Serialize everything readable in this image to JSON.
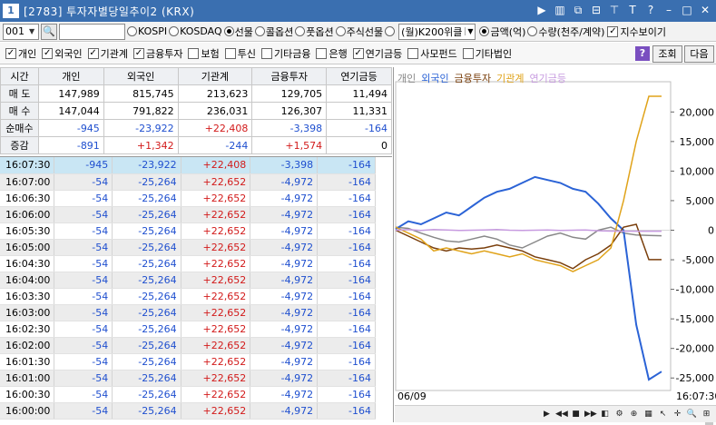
{
  "window": {
    "number": "1",
    "title": "[2783] 투자자별당일추이2 (KRX)",
    "icons": [
      "arrow-right-icon",
      "menu-icon",
      "copy-icon",
      "link-icon",
      "pin-icon",
      "text-icon",
      "help-icon",
      "minimize-icon",
      "maximize-icon",
      "close-icon"
    ]
  },
  "toolbar1": {
    "code_value": "001",
    "market_options": [
      "KOSPI",
      "KOSDAQ",
      "선물",
      "콜옵션",
      "풋옵션",
      "주식선물"
    ],
    "market_selected": "선물",
    "select_value": "(월)K200위클",
    "unit_options": [
      "금액(억)",
      "수량(천주/계약)"
    ],
    "unit_selected": "금액(억)",
    "index_check_label": "지수보이기"
  },
  "toolbar2": {
    "checks": [
      {
        "label": "개인",
        "checked": true
      },
      {
        "label": "외국인",
        "checked": true
      },
      {
        "label": "기관계",
        "checked": true
      },
      {
        "label": "금융투자",
        "checked": true
      },
      {
        "label": "보험",
        "checked": false
      },
      {
        "label": "투신",
        "checked": false
      },
      {
        "label": "기타금융",
        "checked": false
      },
      {
        "label": "은행",
        "checked": false
      },
      {
        "label": "연기금등",
        "checked": true
      },
      {
        "label": "사모펀드",
        "checked": false
      },
      {
        "label": "기타법인",
        "checked": false
      }
    ],
    "help_label": "?",
    "query_label": "조회",
    "next_label": "다음"
  },
  "summary": {
    "headers": [
      "시간",
      "개인",
      "외국인",
      "기관계",
      "금융투자",
      "연기금등"
    ],
    "rows": [
      {
        "label": "매 도",
        "values": [
          "147,989",
          "815,745",
          "213,623",
          "129,705",
          "11,494"
        ],
        "colors": [
          "",
          "",
          "",
          "",
          ""
        ]
      },
      {
        "label": "매 수",
        "values": [
          "147,044",
          "791,822",
          "236,031",
          "126,307",
          "11,331"
        ],
        "colors": [
          "",
          "",
          "",
          "",
          ""
        ]
      },
      {
        "label": "순매수",
        "values": [
          "-945",
          "-23,922",
          "+22,408",
          "-3,398",
          "-164"
        ],
        "colors": [
          "blue",
          "blue",
          "red",
          "blue",
          "blue"
        ]
      },
      {
        "label": "증감",
        "values": [
          "-891",
          "+1,342",
          "-244",
          "+1,574",
          "0"
        ],
        "colors": [
          "blue",
          "red",
          "blue",
          "red",
          ""
        ]
      }
    ]
  },
  "timeline": [
    {
      "time": "16:07:30",
      "values": [
        "-945",
        "-23,922",
        "+22,408",
        "-3,398",
        "-164"
      ]
    },
    {
      "time": "16:07:00",
      "values": [
        "-54",
        "-25,264",
        "+22,652",
        "-4,972",
        "-164"
      ]
    },
    {
      "time": "16:06:30",
      "values": [
        "-54",
        "-25,264",
        "+22,652",
        "-4,972",
        "-164"
      ]
    },
    {
      "time": "16:06:00",
      "values": [
        "-54",
        "-25,264",
        "+22,652",
        "-4,972",
        "-164"
      ]
    },
    {
      "time": "16:05:30",
      "values": [
        "-54",
        "-25,264",
        "+22,652",
        "-4,972",
        "-164"
      ]
    },
    {
      "time": "16:05:00",
      "values": [
        "-54",
        "-25,264",
        "+22,652",
        "-4,972",
        "-164"
      ]
    },
    {
      "time": "16:04:30",
      "values": [
        "-54",
        "-25,264",
        "+22,652",
        "-4,972",
        "-164"
      ]
    },
    {
      "time": "16:04:00",
      "values": [
        "-54",
        "-25,264",
        "+22,652",
        "-4,972",
        "-164"
      ]
    },
    {
      "time": "16:03:30",
      "values": [
        "-54",
        "-25,264",
        "+22,652",
        "-4,972",
        "-164"
      ]
    },
    {
      "time": "16:03:00",
      "values": [
        "-54",
        "-25,264",
        "+22,652",
        "-4,972",
        "-164"
      ]
    },
    {
      "time": "16:02:30",
      "values": [
        "-54",
        "-25,264",
        "+22,652",
        "-4,972",
        "-164"
      ]
    },
    {
      "time": "16:02:00",
      "values": [
        "-54",
        "-25,264",
        "+22,652",
        "-4,972",
        "-164"
      ]
    },
    {
      "time": "16:01:30",
      "values": [
        "-54",
        "-25,264",
        "+22,652",
        "-4,972",
        "-164"
      ]
    },
    {
      "time": "16:01:00",
      "values": [
        "-54",
        "-25,264",
        "+22,652",
        "-4,972",
        "-164"
      ]
    },
    {
      "time": "16:00:30",
      "values": [
        "-54",
        "-25,264",
        "+22,652",
        "-4,972",
        "-164"
      ]
    },
    {
      "time": "16:00:00",
      "values": [
        "-54",
        "-25,264",
        "+22,652",
        "-4,972",
        "-164"
      ]
    }
  ],
  "colors": {
    "title_bar": "#3a6fb0",
    "negative": "#1f4fcf",
    "positive": "#d21a1a",
    "selected_row": "#c9e6f4"
  },
  "chart_data": {
    "type": "line",
    "legend": [
      "개인",
      "외국인",
      "금융투자",
      "기관계",
      "연기금등"
    ],
    "legend_colors": [
      "#888888",
      "#2b63d6",
      "#7a3f0c",
      "#e0a31a",
      "#c79be0"
    ],
    "x_start_label": "06/09",
    "x_end_label": "16:07:30",
    "ylim": [
      -26500,
      24500
    ],
    "yticks": [
      20000,
      15000,
      10000,
      5000,
      0,
      -5000,
      -10000,
      -15000,
      -20000,
      -25000
    ],
    "ytick_labels": [
      "20,000",
      "15,000",
      "10,000",
      "5,000",
      "0",
      "-5,000",
      "-10,000",
      "-15,000",
      "-20,000",
      "-25,000"
    ],
    "series": [
      {
        "name": "개인",
        "color": "#888888",
        "values": [
          500,
          300,
          -500,
          -1200,
          -1800,
          -2000,
          -1500,
          -1000,
          -1500,
          -2500,
          -3000,
          -2000,
          -1000,
          -500,
          -1200,
          -1500,
          0,
          500,
          -500,
          -800,
          -900,
          -945
        ]
      },
      {
        "name": "외국인",
        "color": "#2b63d6",
        "values": [
          200,
          1500,
          1000,
          2000,
          3000,
          2500,
          4000,
          5500,
          6500,
          7000,
          8000,
          9000,
          8500,
          8000,
          7000,
          6500,
          4500,
          2000,
          0,
          -16000,
          -25264,
          -23922
        ]
      },
      {
        "name": "금융투자",
        "color": "#7a3f0c",
        "values": [
          0,
          -1000,
          -2000,
          -3000,
          -3500,
          -3000,
          -3200,
          -3000,
          -2500,
          -3000,
          -3500,
          -4500,
          -5000,
          -5500,
          -6500,
          -5000,
          -4000,
          -2500,
          500,
          1000,
          -4972,
          -4972
        ]
      },
      {
        "name": "기관계",
        "color": "#e0a31a",
        "values": [
          500,
          -500,
          -1500,
          -3500,
          -3000,
          -3500,
          -4000,
          -3500,
          -4000,
          -4500,
          -4000,
          -5000,
          -5500,
          -6000,
          -7000,
          -6000,
          -5000,
          -3000,
          5000,
          15000,
          22652,
          22652
        ]
      },
      {
        "name": "연기금등",
        "color": "#c79be0",
        "values": [
          0,
          100,
          -50,
          100,
          50,
          -50,
          0,
          50,
          100,
          0,
          -50,
          0,
          50,
          -50,
          0,
          50,
          -100,
          -150,
          -164,
          -164,
          -164,
          -164
        ]
      }
    ]
  }
}
